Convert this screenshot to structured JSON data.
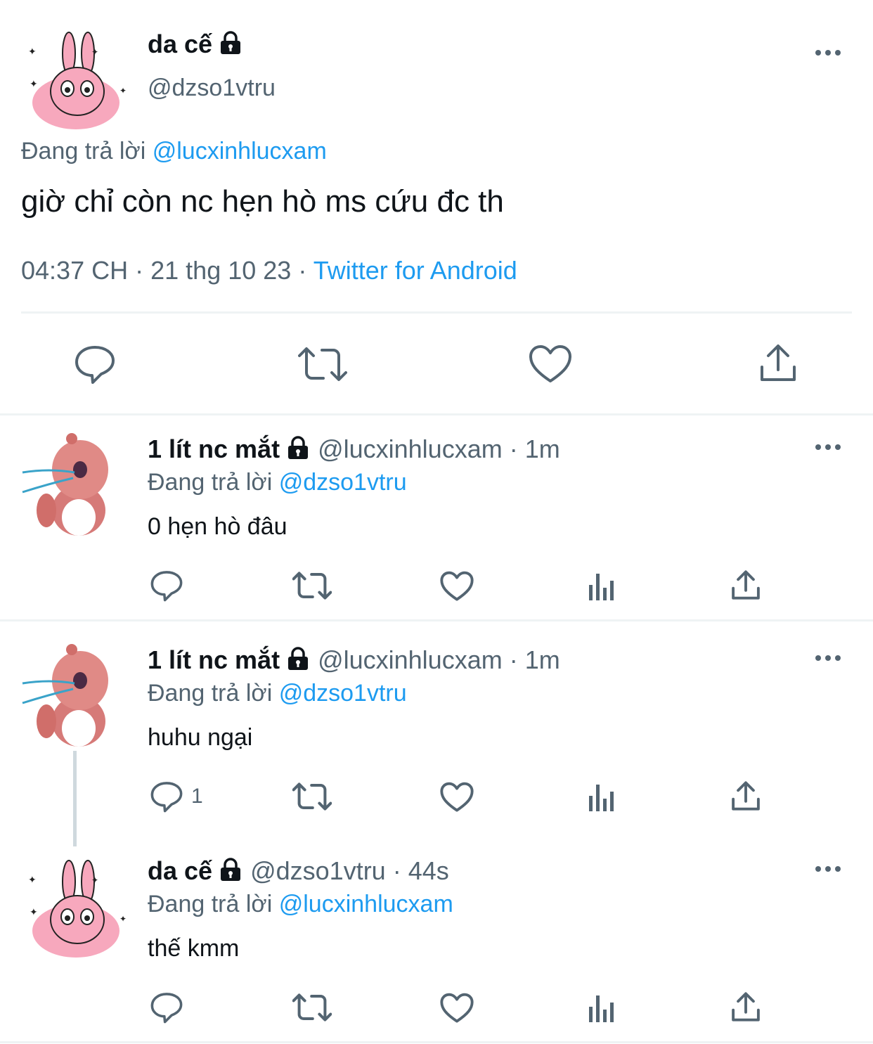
{
  "main_tweet": {
    "display_name": "da cế",
    "handle": "@dzso1vtru",
    "replying_prefix": "Đang trả lời",
    "replying_to": "@lucxinhlucxam",
    "text": "giờ chỉ còn nc hẹn hò ms cứu đc th",
    "time": "04:37 CH",
    "separator": "·",
    "date": "21 thg 10 23",
    "source": "Twitter for Android"
  },
  "replies": [
    {
      "display_name": "1 lít nc mắt",
      "handle": "@lucxinhlucxam",
      "age": "1m",
      "replying_prefix": "Đang trả lời",
      "replying_to": "@dzso1vtru",
      "text": "0 hẹn hò đâu",
      "reply_count": ""
    },
    {
      "display_name": "1 lít nc mắt",
      "handle": "@lucxinhlucxam",
      "age": "1m",
      "replying_prefix": "Đang trả lời",
      "replying_to": "@dzso1vtru",
      "text": "huhu ngại",
      "reply_count": "1"
    },
    {
      "display_name": "da cế",
      "handle": "@dzso1vtru",
      "age": "44s",
      "replying_prefix": "Đang trả lời",
      "replying_to": "@lucxinhlucxam",
      "text": "thế kmm",
      "reply_count": ""
    }
  ],
  "icons": [
    "more-icon",
    "lock-icon",
    "reply-icon",
    "retweet-icon",
    "like-icon",
    "views-icon",
    "share-icon"
  ],
  "colors": {
    "accent": "#1d9bf0",
    "muted": "#536471",
    "text": "#0f1419",
    "divider": "#eff3f4",
    "avatar_pink": "#f7a8bd"
  }
}
